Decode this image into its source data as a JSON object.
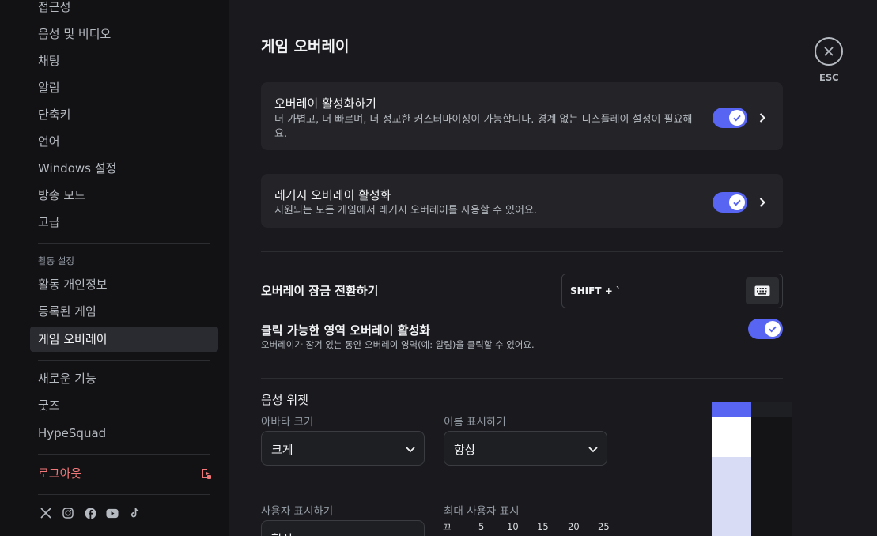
{
  "sidebar": {
    "items": [
      {
        "label": "접근성"
      },
      {
        "label": "음성 및 비디오"
      },
      {
        "label": "채팅"
      },
      {
        "label": "알림"
      },
      {
        "label": "단축키"
      },
      {
        "label": "언어"
      },
      {
        "label": "Windows 설정"
      },
      {
        "label": "방송 모드"
      },
      {
        "label": "고급"
      }
    ],
    "activity_header": "활동 설정",
    "activity_items": [
      {
        "label": "활동 개인정보"
      },
      {
        "label": "등록된 게임"
      },
      {
        "label": "게임 오버레이"
      }
    ],
    "extra_items": [
      {
        "label": "새로운 기능"
      },
      {
        "label": "굿즈"
      },
      {
        "label": "HypeSquad"
      }
    ],
    "logout": "로그아웃",
    "social_icons": [
      "x-icon",
      "instagram-icon",
      "facebook-icon",
      "youtube-icon",
      "tiktok-icon"
    ]
  },
  "main": {
    "title": "게임 오버레이",
    "overlay_card": {
      "title": "오버레이 활성화하기",
      "desc": "더 가볍고, 더 빠르며, 더 정교한 커스터마이징이 가능합니다. 경계 없는 디스플레이 설정이 필요해요.",
      "enabled": true
    },
    "legacy_card": {
      "title": "레거시 오버레이 활성화",
      "desc": "지원되는 모든 게임에서 레거시 오버레이를 사용할 수 있어요.",
      "enabled": true
    },
    "lock_toggle": {
      "title": "오버레이 잠금 전환하기",
      "keybind": "SHIFT + `"
    },
    "clickable": {
      "title": "클릭 가능한 영역 오버레이 활성화",
      "desc": "오버레이가 잠겨 있는 동안 오버레이 영역(예: 알림)을 클릭할 수 있어요.",
      "enabled": true
    },
    "voice_widget": {
      "title": "음성 위젯",
      "avatar_size_label": "아바타 크기",
      "avatar_size_value": "크게",
      "show_names_label": "이름 표시하기",
      "show_names_value": "항상",
      "show_users_label": "사용자 표시하기",
      "show_users_value": "항상",
      "max_users_label": "최대 사용자 표시",
      "max_users_ticks": [
        "끄",
        "5",
        "10",
        "15",
        "20",
        "25"
      ]
    },
    "esc_label": "ESC"
  },
  "colors": {
    "accent": "#5865f2",
    "logout": "#f0787a"
  }
}
